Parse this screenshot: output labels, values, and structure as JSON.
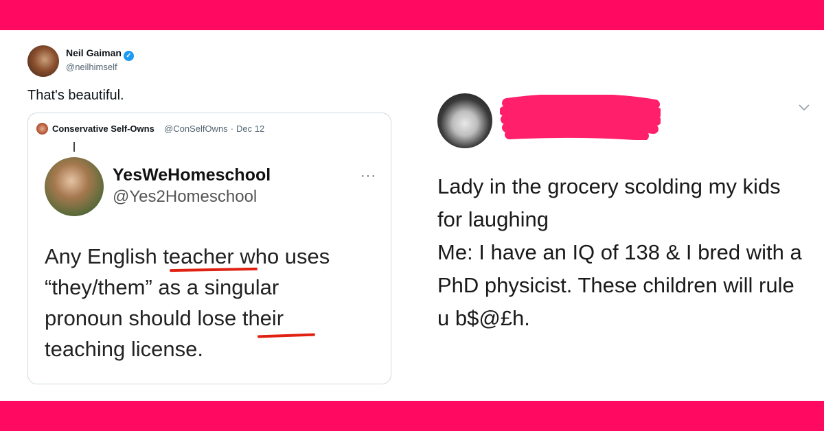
{
  "main_tweet": {
    "author_name": "Neil Gaiman",
    "author_handle": "@neilhimself",
    "text": "That's beautiful."
  },
  "quoted_tweet": {
    "author_name": "Conservative Self-Owns",
    "author_handle": "@ConSelfOwns",
    "separator": "·",
    "date": "Dec 12",
    "inner": {
      "name": "YesWeHomeschool",
      "handle": "@Yes2Homeschool",
      "more": "···",
      "body_lines": [
        "Any English teacher who uses",
        "“they/them” as a singular",
        "pronoun should lose their",
        "teaching license."
      ]
    }
  },
  "right_tweet": {
    "body_lines": [
      "Lady in the grocery scolding my kids",
      "for laughing",
      "Me: I have an IQ of 138 & I bred with a",
      "PhD physicist. These children will rule",
      "u b$@£h."
    ]
  },
  "colors": {
    "band": "#ff0a60",
    "verified": "#1d9bf0",
    "underline": "#e02010",
    "scribble": "#ff1f6b"
  },
  "icons": [
    "verified-badge-icon",
    "more-dots-icon",
    "chevron-down-icon"
  ]
}
